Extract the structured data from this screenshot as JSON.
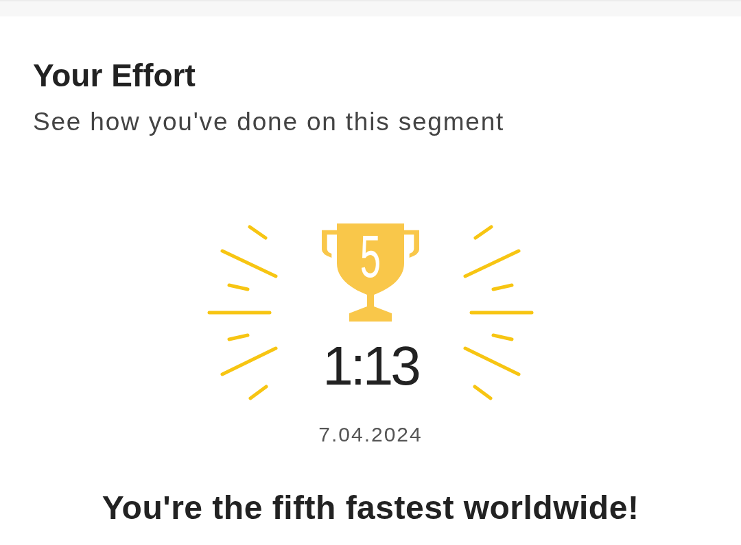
{
  "header": {
    "title": "Your Effort",
    "subtitle": "See how you've done on this segment"
  },
  "effort": {
    "rank": "5",
    "time": "1:13",
    "date": "7.04.2024",
    "message": "You're the fifth fastest worldwide!"
  }
}
